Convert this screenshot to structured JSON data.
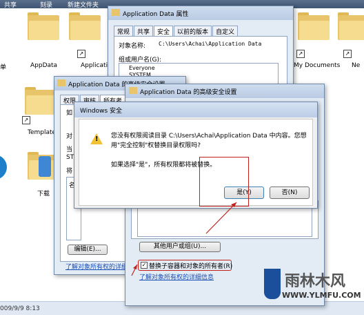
{
  "explorer": {
    "toolbar": [
      "共享",
      "刻录",
      "新建文件夹"
    ],
    "icons": [
      "单",
      "AppData",
      "Applicatio",
      "Template",
      "下载",
      "My Documents",
      "Ne"
    ],
    "status": "009/9/9 8:13"
  },
  "props": {
    "title": "Application Data 属性",
    "tabs": [
      "常规",
      "共享",
      "安全",
      "以前的版本",
      "自定义"
    ],
    "object_label": "对象名称:",
    "object_path": "C:\\Users\\Achai\\Application Data",
    "group_label": "组或用户名(G):",
    "users": [
      "Everyone",
      "SYSTEM"
    ]
  },
  "adv_back": {
    "title": "Application Data 的高级安全设置",
    "tabs": [
      "权限",
      "审核",
      "所有者"
    ],
    "left_chars": [
      "如",
      "对",
      "当",
      "ST",
      "将",
      "名"
    ],
    "edit_button": "编辑(E)...",
    "link": "了解对象所有权的详细"
  },
  "adv_front": {
    "title": "Application Data 的高级安全设置",
    "other_button": "其他用户或组(U)...",
    "checkbox_label": "替换子容器和对象的所有者(R)",
    "link": "了解对象所有权的详细信息",
    "checkbox_checked": true
  },
  "dialog": {
    "title": "Windows 安全",
    "message_line1": "您没有权限阅读目录 C:\\Users\\Achai\\Application Data 中内容。您想",
    "message_line2": "用\"完全控制\"权替换目录权限吗?",
    "message_line3": "如果选择\"是\"，所有权限都将被替换。",
    "yes_button": "是(Y)",
    "no_button": "否(N)"
  },
  "watermark": {
    "brand": "雨林木风",
    "url": "WWW.YLMFU.COM"
  }
}
